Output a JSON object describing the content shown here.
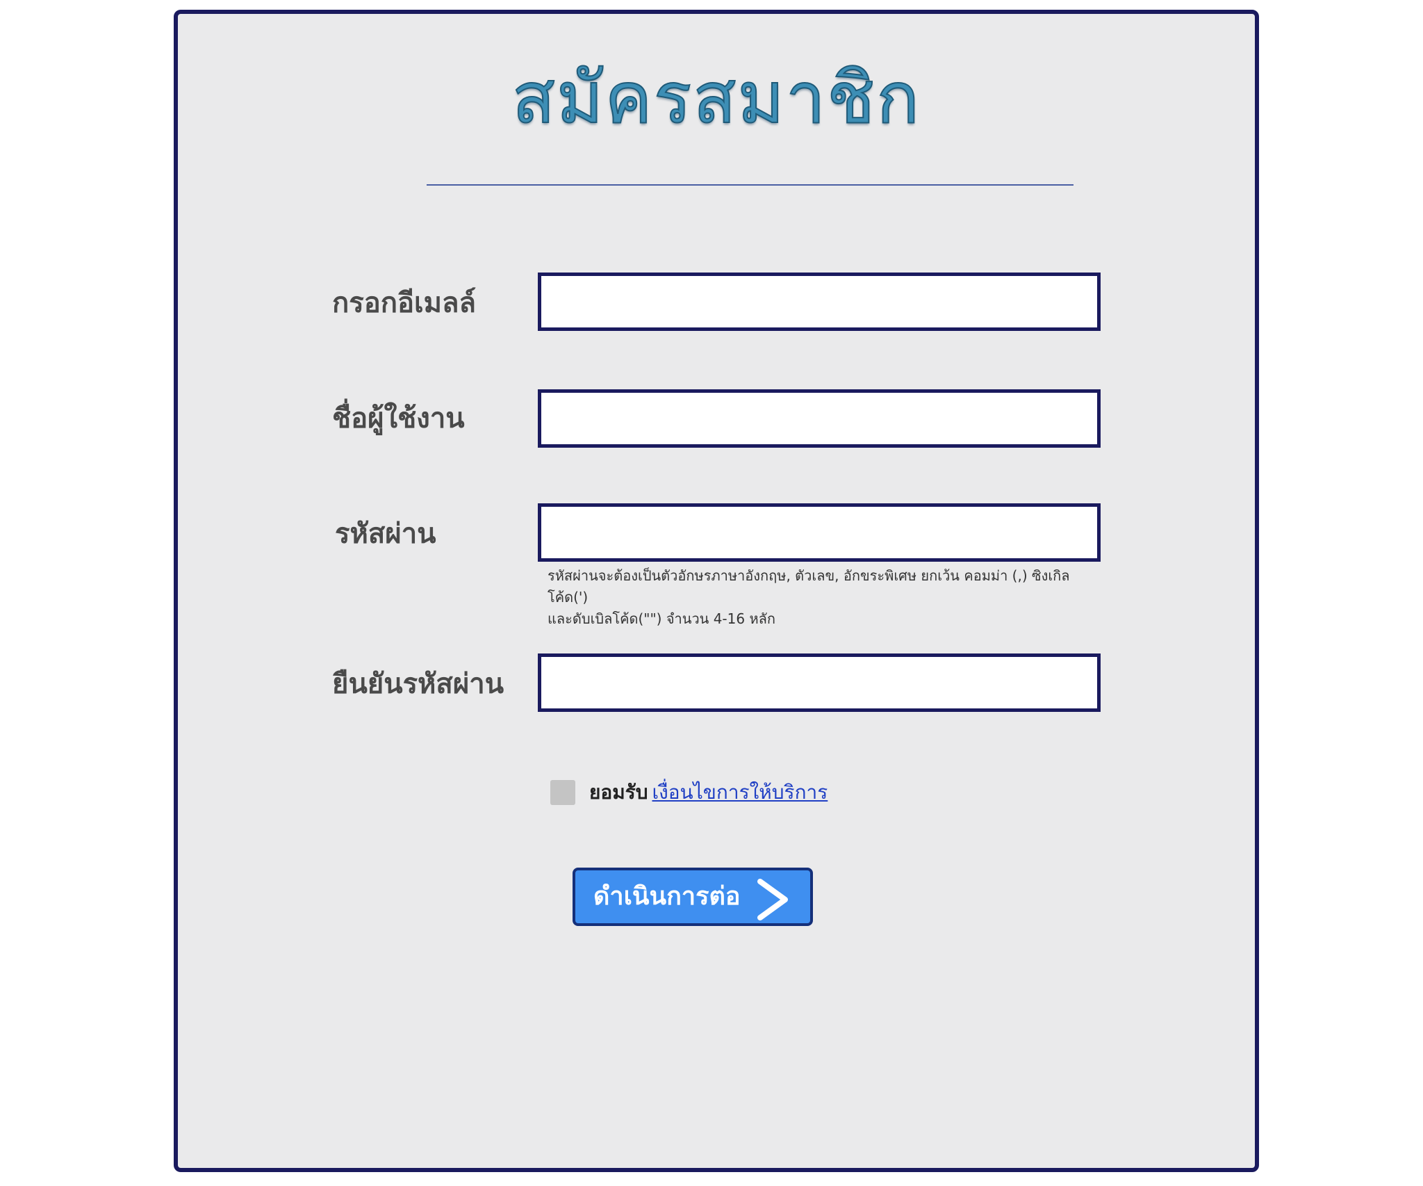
{
  "form": {
    "title": "สมัครสมาชิก",
    "email_label": "กรอกอีเมลล์",
    "email_value": "",
    "username_label": "ชื่อผู้ใช้งาน",
    "username_value": "",
    "password_label": "รหัสผ่าน",
    "password_value": "",
    "password_hint_line1": "รหัสผ่านจะต้องเป็นตัวอักษรภาษาอังกฤษ, ตัวเลข, อักขระพิเศษ ยกเว้น คอมม่า (,) ซิงเกิลโค้ด(')",
    "password_hint_line2": "และดับเบิลโค้ด(\"\") จำนวน 4-16 หลัก",
    "confirm_label": "ยืนยันรหัสผ่าน",
    "confirm_value": "",
    "accept_text": "ยอมรับ",
    "terms_link": "เงื่อนไขการให้บริการ",
    "submit_label": "ดำเนินการต่อ",
    "submit_icon": "chevron-right-icon"
  },
  "colors": {
    "panel_border": "#1a1a5e",
    "panel_bg": "#eaeaeb",
    "title": "#3d8eb5",
    "button_bg": "#3f8ff0",
    "link": "#1f3fc4"
  }
}
